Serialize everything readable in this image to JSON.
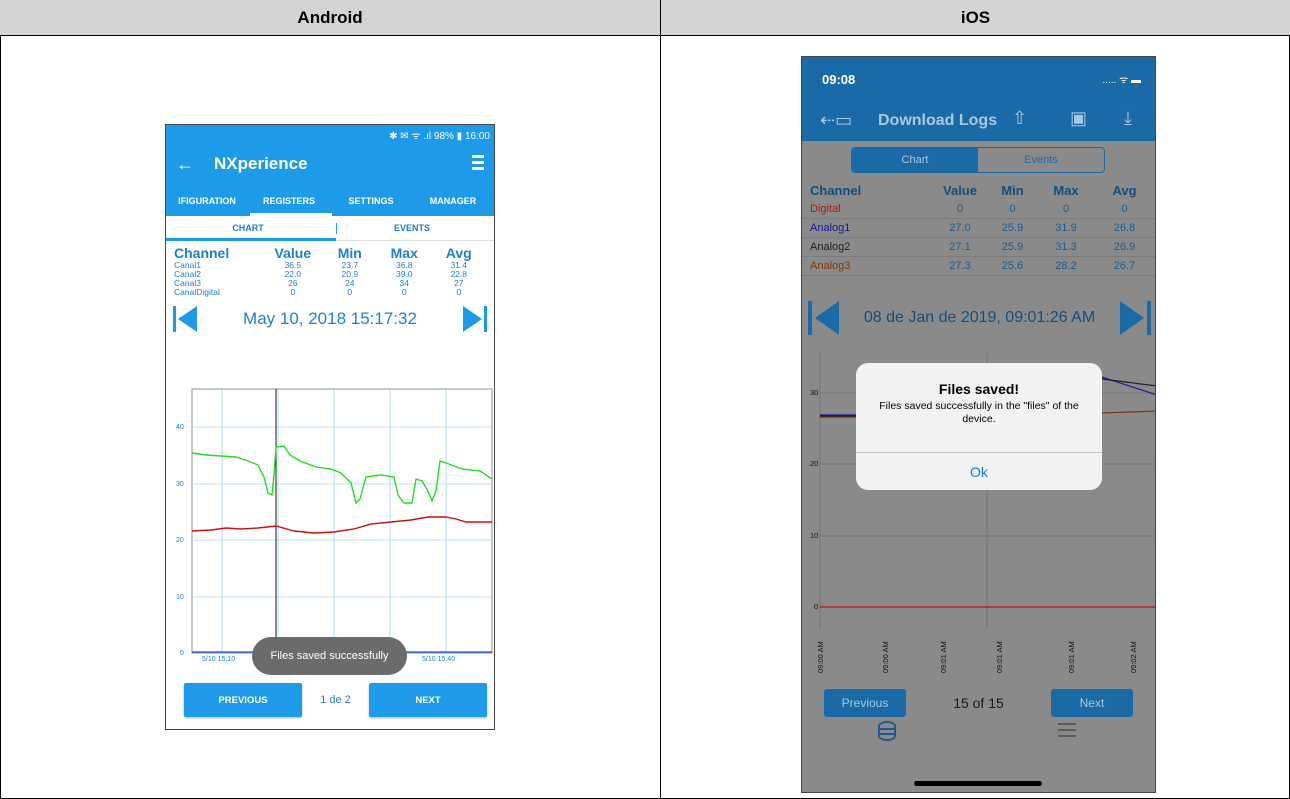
{
  "headers": {
    "left": "Android",
    "right": "iOS"
  },
  "android": {
    "status_text": "✱ ✉ ᯤ .ıl 98% ▮ 16:00",
    "app_title": "NXperience",
    "back_icon": "arrow-left-icon",
    "tabs": [
      "IFIGURATION",
      "REGISTERS",
      "SETTINGS",
      "MANAGER"
    ],
    "subtabs": [
      "CHART",
      "EVENTS"
    ],
    "table": {
      "headers": [
        "Channel",
        "Value",
        "Min",
        "Max",
        "Avg"
      ],
      "rows": [
        [
          "Canal1",
          "36.5",
          "23.7",
          "36.8",
          "31.4"
        ],
        [
          "Canal2",
          "22.0",
          "20.9",
          "39.0",
          "22.8"
        ],
        [
          "Canal3",
          "26",
          "24",
          "34",
          "27"
        ],
        [
          "CanalDigital",
          "0",
          "0",
          "0",
          "0"
        ]
      ]
    },
    "date": "May 10, 2018 15:17:32",
    "toast": "Files saved successfully",
    "prev_label": "PREVIOUS",
    "next_label": "NEXT",
    "page": "1 de 2",
    "chart": {
      "y_ticks": [
        "0",
        "10",
        "20",
        "30",
        "40"
      ],
      "x_ticks": [
        "5/10 15:10",
        "5/10 15:40"
      ],
      "series_colors": [
        "#22dd22",
        "#cc1111",
        "#1155ee"
      ]
    }
  },
  "ios": {
    "time": "09:08",
    "status_right": "..... ᯤ ▬",
    "nav_title": "Download Logs",
    "segments": [
      "Chart",
      "Events"
    ],
    "table": {
      "headers": [
        "Channel",
        "Value",
        "Min",
        "Max",
        "Avg"
      ],
      "rows": [
        {
          "name": "Digital",
          "color": "#b01818",
          "vals": [
            "0",
            "0",
            "0",
            "0"
          ]
        },
        {
          "name": "Analog1",
          "color": "#1a1a9a",
          "vals": [
            "27.0",
            "25.9",
            "31.9",
            "26.8"
          ]
        },
        {
          "name": "Analog2",
          "color": "#222222",
          "vals": [
            "27.1",
            "25.9",
            "31.3",
            "26.9"
          ]
        },
        {
          "name": "Analog3",
          "color": "#7a3a10",
          "vals": [
            "27.3",
            "25.6",
            "28.2",
            "26.7"
          ]
        }
      ]
    },
    "date": "08 de Jan de 2019, 09:01:26 AM",
    "alert": {
      "title": "Files saved!",
      "message": "Files saved successfully in the \"files\" of the device.",
      "ok": "Ok"
    },
    "prev_label": "Previous",
    "next_label": "Next",
    "page": "15 of 15",
    "chart": {
      "y_ticks": [
        "0",
        "10",
        "20",
        "30"
      ],
      "x_ticks": [
        "09:00 AM",
        "09:00 AM",
        "09:01 AM",
        "09:01 AM",
        "09:01 AM",
        "09:02 AM"
      ]
    }
  }
}
